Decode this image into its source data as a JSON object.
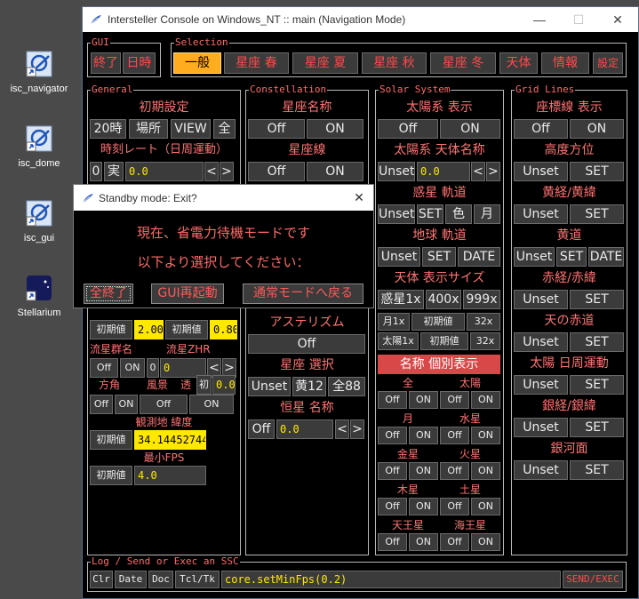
{
  "desktop": {
    "icons": [
      {
        "label": "isc_navigator"
      },
      {
        "label": "isc_dome"
      },
      {
        "label": "isc_gui"
      },
      {
        "label": "Stellarium"
      }
    ]
  },
  "window": {
    "title": "Intersteller Console on Windows_NT :: main (Navigation Mode)",
    "minimize": "—",
    "maximize": "☐",
    "close": "✕"
  },
  "gui": {
    "label": "GUI",
    "quit": "終了",
    "datetime": "日時"
  },
  "selection": {
    "label": "Selection",
    "tabs": [
      "一般",
      "星座 春",
      "星座 夏",
      "星座 秋",
      "星座 冬",
      "天体",
      "情報"
    ],
    "settings": "設定"
  },
  "general": {
    "label": "General",
    "initial_settings": "初期設定",
    "btn_20": "20時",
    "btn_place": "場所",
    "btn_view": "VIEW",
    "btn_all": "全",
    "timerate_label": "時刻レート（日周運動）",
    "btn_zero": "0",
    "btn_real": "実",
    "timerate_value": "0.0",
    "left": "<",
    "right": ">",
    "init1": "初期値",
    "init1_value": "2.00",
    "init2": "初期値",
    "init2_value": "0.80",
    "meteor_label": "流星群名",
    "zhr_label": "流星ZHR",
    "meteor_off": "Off",
    "meteor_on": "ON",
    "zhr_zero": "0",
    "zhr_value": "0",
    "dir_label": "方角",
    "landscape_label": "風景",
    "trans_label": "透",
    "dir_off": "Off",
    "dir_on": "ON",
    "land_off": "Off",
    "land_on": "ON",
    "trans_init": "初",
    "trans_value": "0.0",
    "lat_label": "観測地 緯度",
    "lat_init": "初期値",
    "lat_value": "34.14452744",
    "fps_label": "最小FPS",
    "fps_init": "初期値",
    "fps_value": "4.0"
  },
  "constellation": {
    "label": "Constellation",
    "names_label": "星座名称",
    "names_off": "Off",
    "names_on": "ON",
    "lines_label": "星座線",
    "lines_off": "Off",
    "lines_on": "ON",
    "asterism_label": "アステリズム",
    "asterism_off": "Off",
    "select_label": "星座 選択",
    "unset": "Unset",
    "zodiac12": "黄12",
    "all88": "全88",
    "star_names_label": "恒星 名称",
    "star_off": "Off",
    "star_value": "0.0"
  },
  "solar": {
    "label": "Solar System",
    "show_label": "太陽系 表示",
    "show_off": "Off",
    "show_on": "ON",
    "names_label": "太陽系 天体名称",
    "names_unset": "Unset",
    "names_value": "0.0",
    "orbit_label": "惑星 軌道",
    "orbit_unset": "Unset",
    "orbit_set": "SET",
    "orbit_color": "色",
    "orbit_moon": "月",
    "earth_orbit_label": "地球 軌道",
    "earth_unset": "Unset",
    "earth_set": "SET",
    "earth_date": "DATE",
    "size_label": "天体 表示サイズ",
    "planet_1x": "惑星1x",
    "planet_400x": "400x",
    "planet_999x": "999x",
    "moon_1x": "月1x",
    "moon_init": "初期値",
    "moon_32x": "32x",
    "sun_1x": "太陽1x",
    "sun_init": "初期値",
    "sun_32x": "32x",
    "individual_label": "名称 個別表示",
    "all_label": "全",
    "sun_label": "太陽",
    "moon_label": "月",
    "mercury_label": "水星",
    "venus_label": "金星",
    "mars_label": "火星",
    "jupiter_label": "木星",
    "saturn_label": "土星",
    "uranus_label": "天王星",
    "neptune_label": "海王星",
    "off": "Off",
    "on": "ON"
  },
  "grid": {
    "label": "Grid Lines",
    "coord_label": "座標線 表示",
    "coord_off": "Off",
    "coord_on": "ON",
    "altaz_label": "高度方位",
    "ecliptic_grid_label": "黄経/黄緯",
    "ecliptic_label": "黄道",
    "equatorial_grid_label": "赤経/赤緯",
    "equator_label": "天の赤道",
    "sun_diurnal_label": "太陽 日周運動",
    "galactic_grid_label": "銀経/銀緯",
    "galactic_label": "銀河面",
    "unset": "Unset",
    "set": "SET",
    "date": "DATE"
  },
  "log": {
    "label": "Log / Send or Exec an SSC",
    "clr": "Clr",
    "date": "Date",
    "doc": "Doc",
    "tcltk": "Tcl/Tk",
    "command": "core.setMinFps(0.2)",
    "send": "SEND/EXEC"
  },
  "dialog": {
    "title": "Standby mode: Exit?",
    "close": "✕",
    "message1": "現在、省電力待機モードです",
    "message2": "以下より選択してください：",
    "btn_quit": "全終了",
    "btn_restart": "GUI再起動",
    "btn_normal": "通常モードへ戻る"
  }
}
